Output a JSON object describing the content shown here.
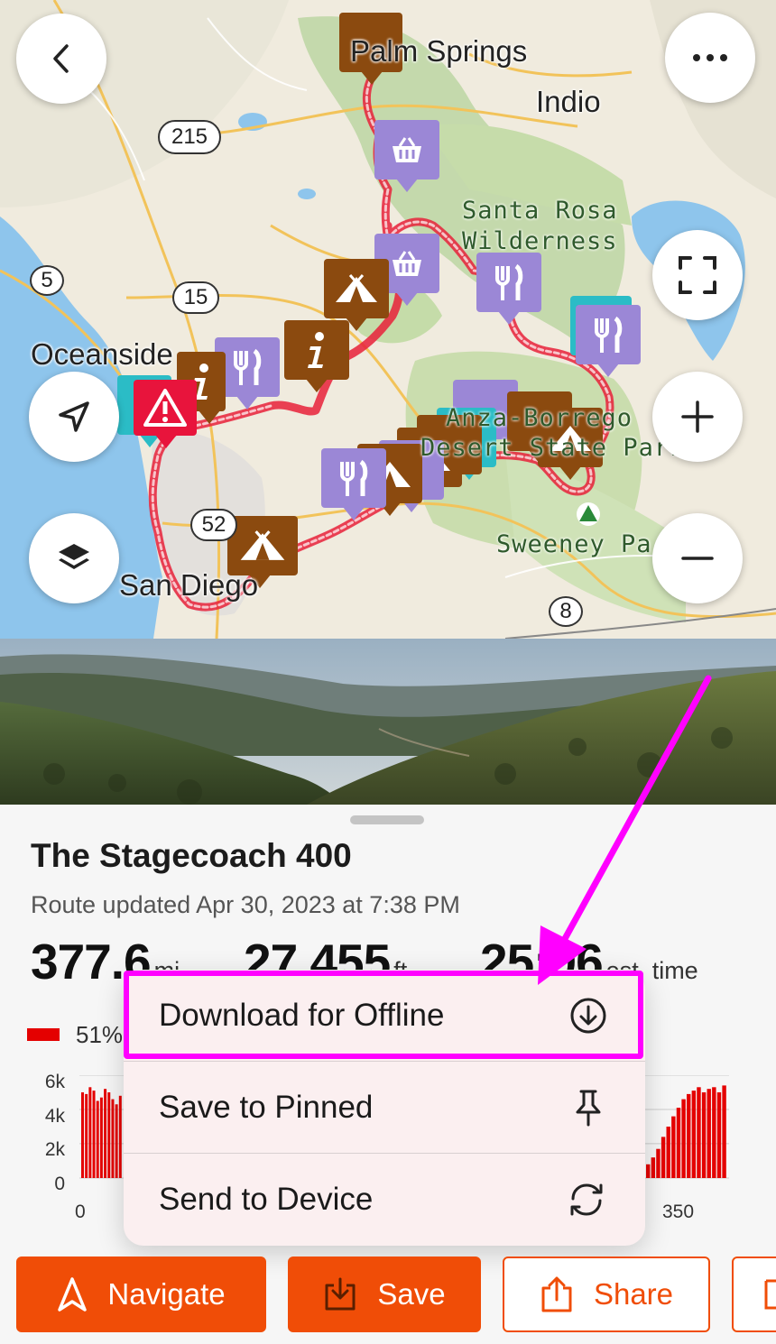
{
  "map": {
    "places": {
      "palm_springs": "Palm Springs",
      "indio": "Indio",
      "oceanside": "Oceanside",
      "san_diego": "San Diego"
    },
    "parks": {
      "santa_rosa_1": "Santa Rosa",
      "santa_rosa_2": "Wilderness",
      "anza_1": "Anza-Borrego",
      "anza_2": "Desert State Park",
      "sweeney": "Sweeney Pa"
    },
    "shields": {
      "r215": "215",
      "r5": "5",
      "r15": "15",
      "r52": "52",
      "r8": "8"
    },
    "buttons": {
      "back_icon": "chevron-left-icon",
      "more_icon": "more-horizontal-icon",
      "fullscreen_icon": "fullscreen-icon",
      "zoom_in_icon": "plus-icon",
      "zoom_out_icon": "minus-icon",
      "locate_icon": "navigation-arrow-icon",
      "layers_icon": "layers-icon"
    },
    "route_color": "#e8213a"
  },
  "route": {
    "title": "The Stagecoach 400",
    "updated": "Route updated Apr 30, 2023 at 7:38 PM",
    "distance": {
      "value": "377.6",
      "unit": "mi"
    },
    "elevation": {
      "value": "27,455",
      "unit": "ft"
    },
    "time": {
      "value": "25:06",
      "unit": "est. time"
    },
    "legend": {
      "color": "#e40000",
      "label": "51%"
    }
  },
  "chart_data": {
    "type": "area",
    "y_ticks": [
      "6k",
      "4k",
      "2k",
      "0"
    ],
    "x_ticks": [
      "0",
      "350"
    ],
    "ylim": [
      0,
      6000
    ],
    "color": "#e40000",
    "series_left": [
      5000,
      4900,
      5300,
      5100,
      4500,
      4700,
      5200,
      5000,
      4600,
      4300,
      4800
    ],
    "series_right": [
      800,
      1200,
      1700,
      2400,
      3000,
      3600,
      4100,
      4600,
      4900,
      5100,
      5300,
      5000,
      5200,
      5300,
      5000,
      5400
    ]
  },
  "menu": {
    "items": [
      {
        "label": "Download for Offline",
        "icon": "download-circle-icon"
      },
      {
        "label": "Save to Pinned",
        "icon": "pin-icon"
      },
      {
        "label": "Send to Device",
        "icon": "sync-icon"
      }
    ],
    "highlight_color": "#ff00ff"
  },
  "actions": {
    "navigate": "Navigate",
    "save": "Save",
    "share": "Share",
    "accent": "#f04d07"
  }
}
